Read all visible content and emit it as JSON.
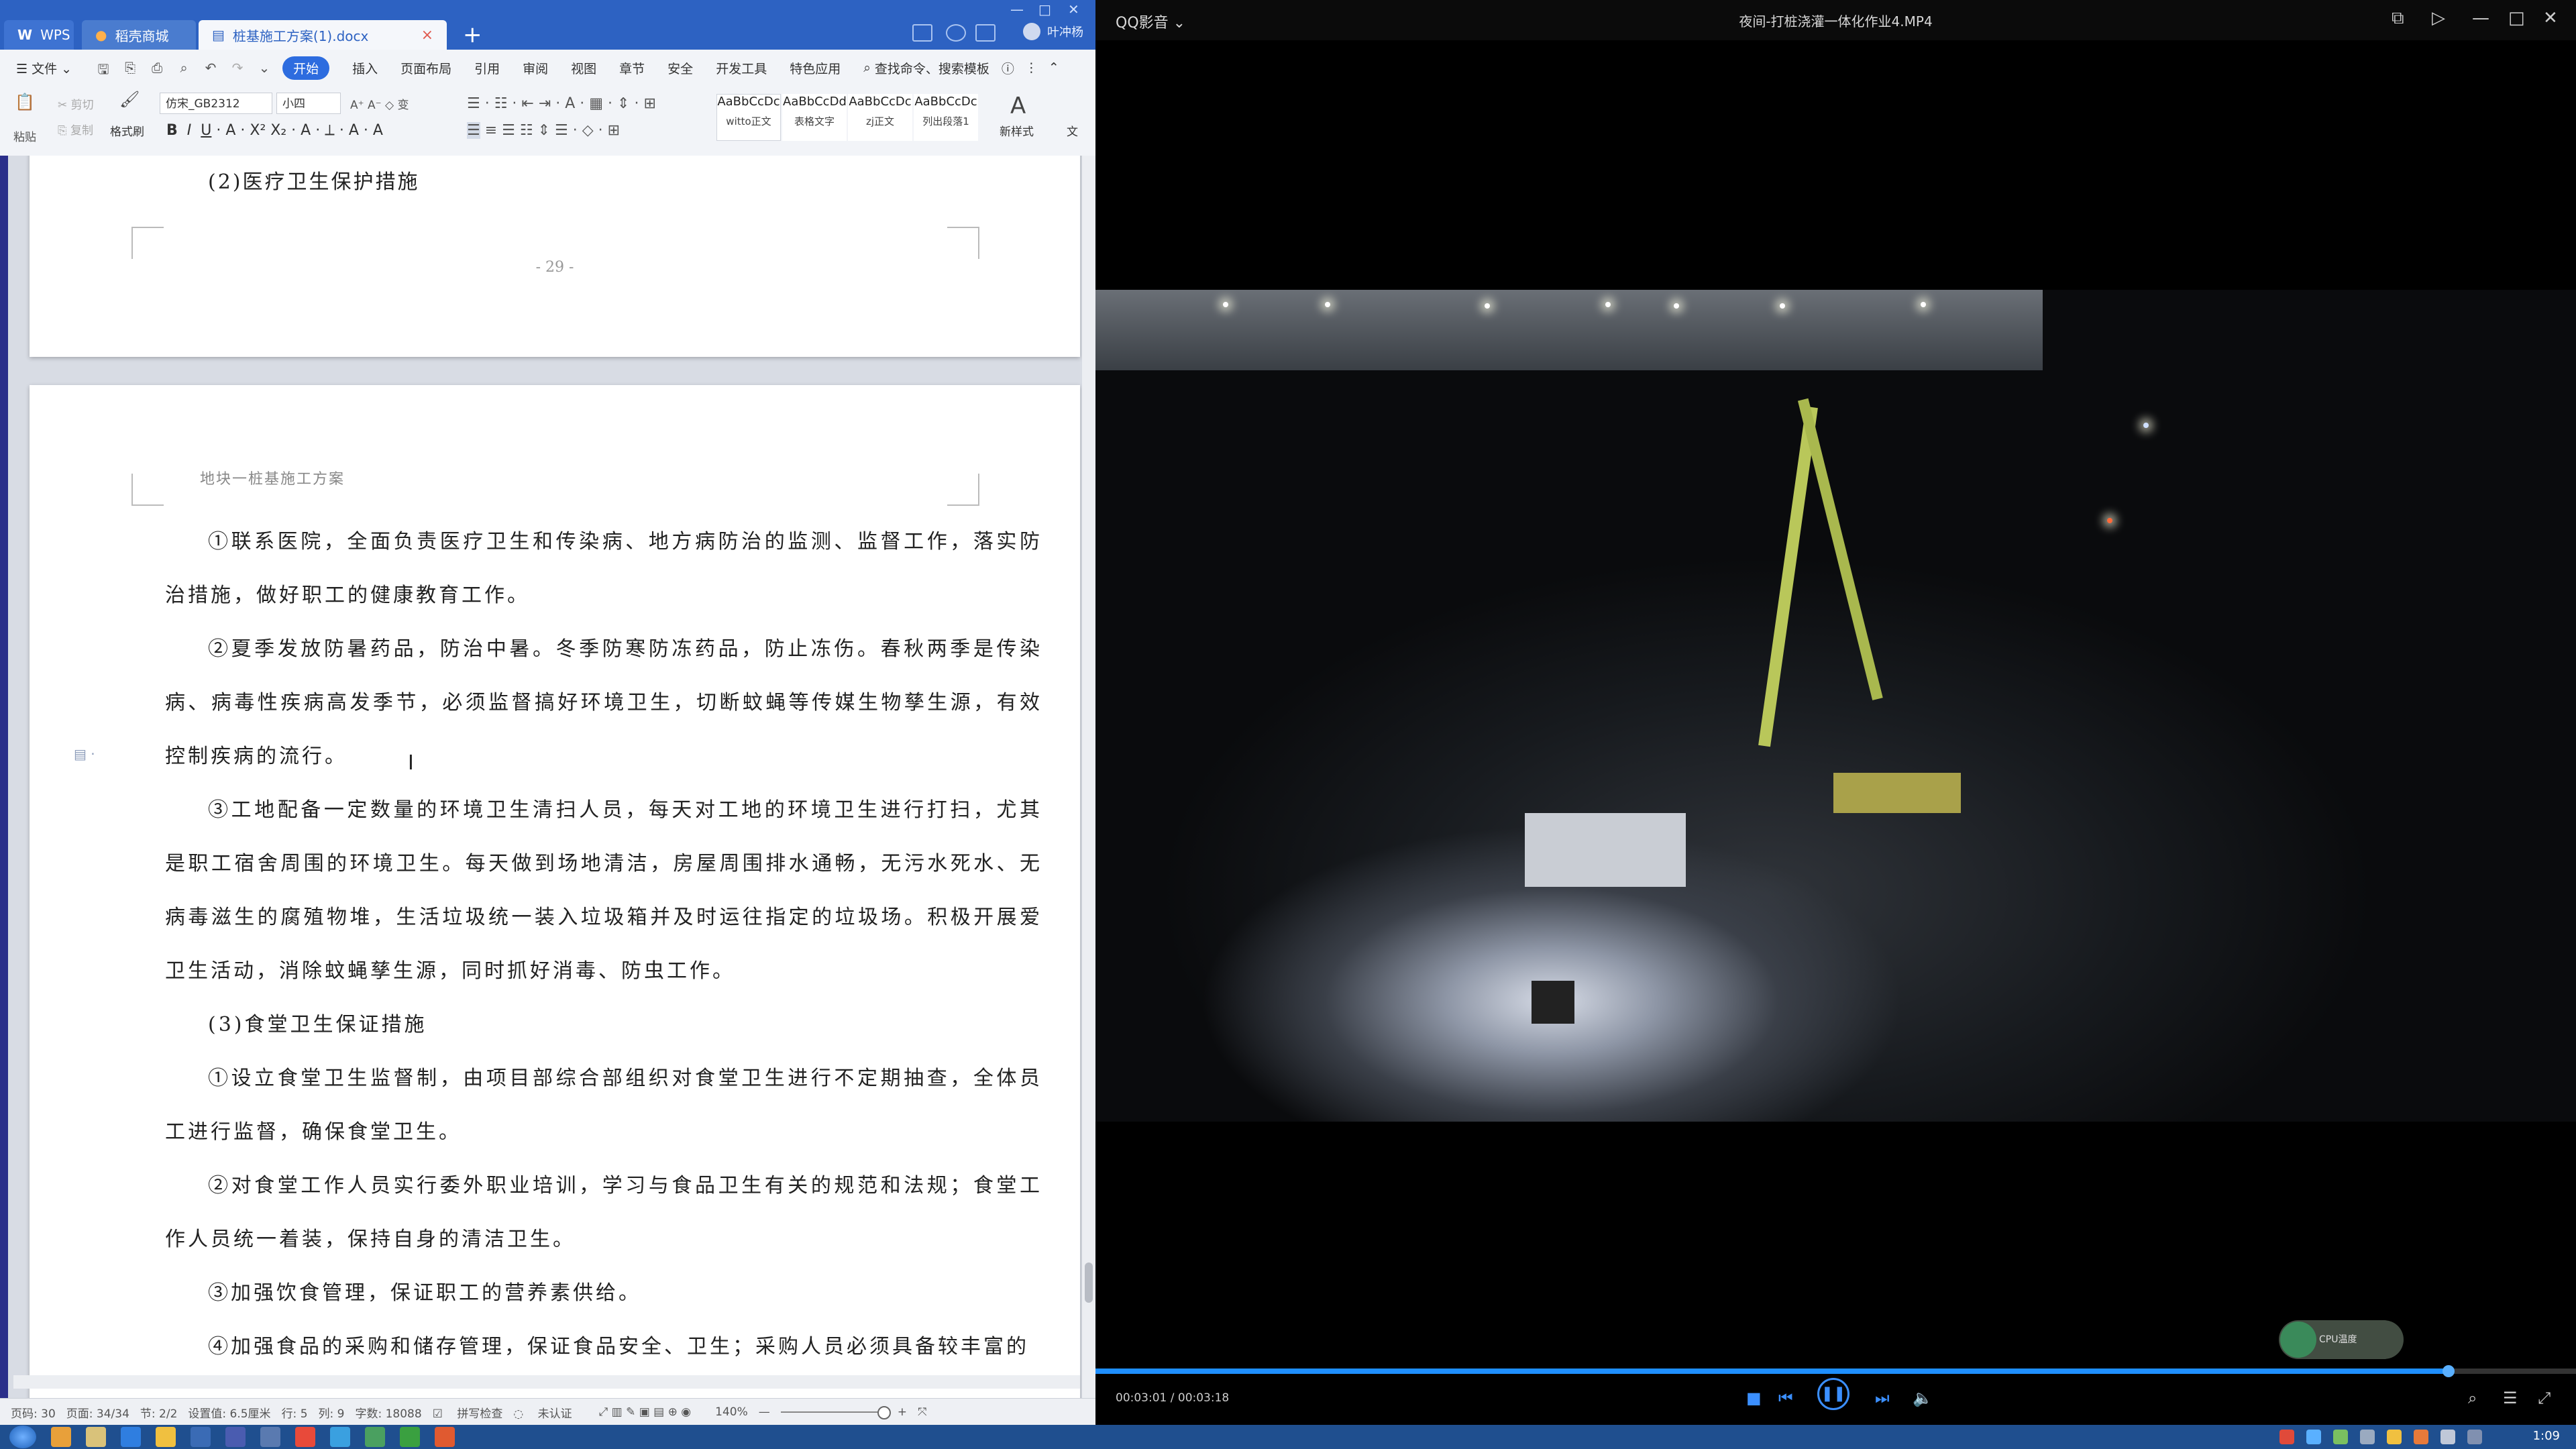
{
  "wps": {
    "tabs": [
      {
        "label": "WPS"
      },
      {
        "label": "稻壳商城"
      },
      {
        "label": "桩基施工方案(1).docx"
      }
    ],
    "user_name": "叶冲杨",
    "menu": {
      "file": "文件",
      "items": [
        "开始",
        "插入",
        "页面布局",
        "引用",
        "审阅",
        "视图",
        "章节",
        "安全",
        "开发工具",
        "特色应用"
      ],
      "search": "查找命令、搜索模板"
    },
    "ribbon": {
      "cut": "剪切",
      "copy": "复制",
      "format_painter": "格式刷",
      "paste": "粘贴",
      "font_name": "仿宋_GB2312",
      "font_size": "小四",
      "styles": [
        {
          "preview": "AaBbCcDc",
          "label": "witto正文"
        },
        {
          "preview": "AaBbCcDd",
          "label": "表格文字"
        },
        {
          "preview": "AaBbCcDc",
          "label": "zj正文"
        },
        {
          "preview": "AaBbCcDc",
          "label": "列出段落1"
        }
      ],
      "new_style": "新样式",
      "text_tool": "文"
    },
    "page1": {
      "heading": "(2)医疗卫生保护措施",
      "page_number": "- 29 -"
    },
    "page2": {
      "header": "地块一桩基施工方案",
      "paragraphs": [
        "①联系医院，全面负责医疗卫生和传染病、地方病防治的监测、监督工作，落实防治措施，做好职工的健康教育工作。",
        "②夏季发放防暑药品，防治中暑。冬季防寒防冻药品，防止冻伤。春秋两季是传染病、病毒性疾病高发季节，必须监督搞好环境卫生，切断蚊蝇等传媒生物孳生源，有效控制疾病的流行。",
        "③工地配备一定数量的环境卫生清扫人员，每天对工地的环境卫生进行打扫，尤其是职工宿舍周围的环境卫生。每天做到场地清洁，房屋周围排水通畅，无污水死水、无病毒滋生的腐殖物堆，生活垃圾统一装入垃圾箱并及时运往指定的垃圾场。积极开展爱卫生活动，消除蚊蝇孳生源，同时抓好消毒、防虫工作。",
        "(3)食堂卫生保证措施",
        "①设立食堂卫生监督制，由项目部综合部组织对食堂卫生进行不定期抽查，全体员工进行监督，确保食堂卫生。",
        "②对食堂工作人员实行委外职业培训，学习与食品卫生有关的规范和法规；食堂工作人员统一着装，保持自身的清洁卫生。",
        "③加强饮食管理，保证职工的营养素供给。",
        "④加强食品的采购和储存管理，保证食品安全、卫生；采购人员必须具备较丰富的"
      ]
    },
    "status": {
      "page_no": "页码: 30",
      "pages": "页面: 34/34",
      "section": "节: 2/2",
      "setting": "设置值: 6.5厘米",
      "row": "行: 5",
      "col": "列: 9",
      "words": "字数: 18088",
      "spell": "拼写检查",
      "cert": "未认证",
      "zoom": "140%"
    }
  },
  "player": {
    "app_name": "QQ影音",
    "file_name": "夜间-打桩浇灌一体化作业4.MP4",
    "time": "00:03:01 / 00:03:18",
    "progress": 0.914,
    "widget_label": "CPU温度"
  },
  "taskbar": {
    "clock": "1:09"
  }
}
